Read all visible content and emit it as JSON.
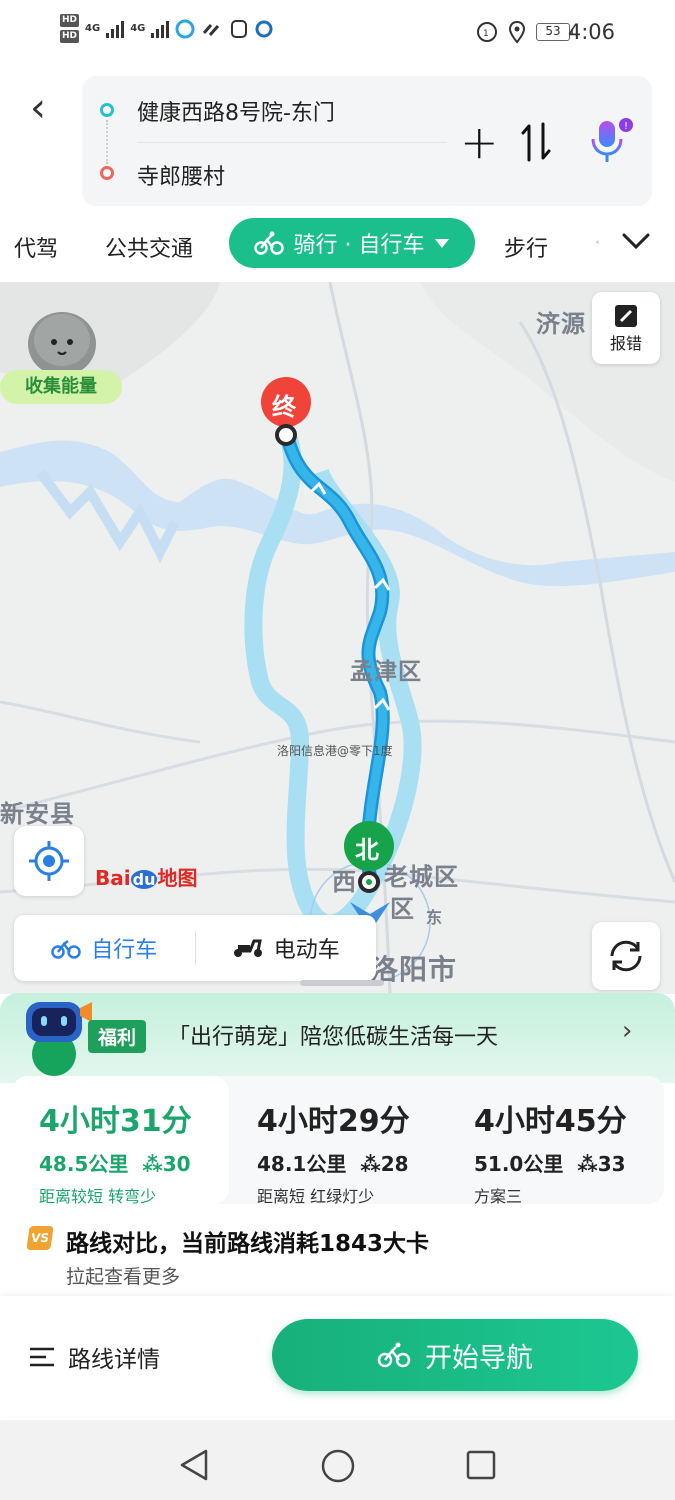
{
  "status_bar": {
    "hd1": "HD",
    "hd2": "HD",
    "net1": "4G",
    "net2": "4G",
    "battery": "53",
    "time": "4:06"
  },
  "search": {
    "start": "健康西路8号院-东门",
    "end": "寺郎腰村"
  },
  "mode_tabs": {
    "designated_driver": "代驾",
    "public_transit": "公共交通",
    "cycling": "骑行 · 自行车",
    "walking": "步行"
  },
  "map": {
    "labels": {
      "jiyuan": "济源",
      "mengjin": "孟津区",
      "xinan": "新安县",
      "laocheng": "老城区",
      "xi": "西",
      "qu": "区",
      "luoyang": "洛阳市",
      "dong": "东",
      "watermark": "洛阳信息港@零下1度"
    },
    "end_marker": "终",
    "north_marker": "北",
    "report_label": "报错",
    "energy_label": "收集能量",
    "baidu_logo_text": "Bai",
    "baidu_logo_du": "du",
    "baidu_logo_suffix": "地图",
    "vehicle": {
      "bicycle": "自行车",
      "ebike": "电动车"
    }
  },
  "promo": {
    "badge": "福利",
    "text": "「出行萌宠」陪您低碳生活每一天"
  },
  "plans": [
    {
      "time": "4小时31分",
      "distance": "48.5公里",
      "lights": "30",
      "tag": "距离较短 转弯少"
    },
    {
      "time": "4小时29分",
      "distance": "48.1公里",
      "lights": "28",
      "tag": "距离短 红绿灯少"
    },
    {
      "time": "4小时45分",
      "distance": "51.0公里",
      "lights": "33",
      "tag": "方案三"
    }
  ],
  "compare": {
    "badge": "VS",
    "title": "路线对比，当前路线消耗1843大卡",
    "subtitle": "拉起查看更多"
  },
  "bottom": {
    "details": "路线详情",
    "start_nav": "开始导航"
  },
  "colors": {
    "accent_green": "#1bbf8c",
    "route_blue": "#35b5ea",
    "alt_route": "#a9dff2",
    "end_red": "#f0443a"
  }
}
